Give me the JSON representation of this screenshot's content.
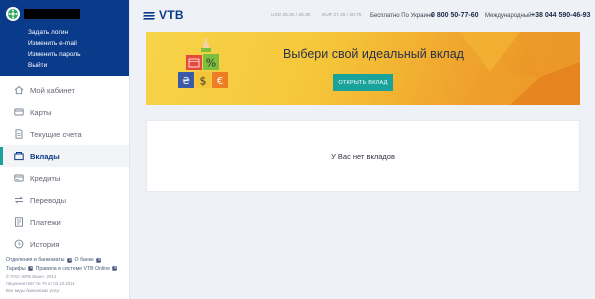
{
  "sidebar": {
    "account_links": [
      "Задать логин",
      "Изменить e-mail",
      "Изменить пароль",
      "Выйти"
    ],
    "menu": [
      {
        "label": "Мой кабинет",
        "icon": "home-icon",
        "active": false
      },
      {
        "label": "Карты",
        "icon": "card-icon",
        "active": false
      },
      {
        "label": "Текущие счета",
        "icon": "document-icon",
        "active": false
      },
      {
        "label": "Вклады",
        "icon": "deposit-icon",
        "active": true
      },
      {
        "label": "Кредиты",
        "icon": "credit-icon",
        "active": false
      },
      {
        "label": "Переводы",
        "icon": "transfer-icon",
        "active": false
      },
      {
        "label": "Платежи",
        "icon": "payment-icon",
        "active": false
      },
      {
        "label": "История",
        "icon": "history-icon",
        "active": false
      }
    ],
    "footer": {
      "branches_link": "Отделения и банкоматы",
      "about_link": "О банке",
      "tariffs_link": "Тарифы",
      "rules_link": "Правила в системе VTB Online",
      "copyright": "© ПАО «ВТБ Банк», 2014",
      "license": "Лицензия НБУ № 79 от 03.10.2011",
      "note": "Все виды банковских услуг"
    }
  },
  "header": {
    "logo_text": "VTB",
    "usd_rate": "USD 25.30 / 26.30",
    "eur_rate": "EUR 27.45 / 28.75",
    "free_label": "Бесплатно По Украине",
    "free_phone": "0 800 50-77-60",
    "intl_label": "Международный",
    "intl_phone": "+38 044 590-46-93"
  },
  "banner": {
    "title": "Выбери свой идеальный вклад",
    "button_label": "ОТКРЫТЬ ВКЛАД",
    "block_glyphs": [
      "%",
      "₴",
      "$",
      "€"
    ]
  },
  "deposits": {
    "empty_text": "У Вас нет вкладов"
  },
  "colors": {
    "brand_blue": "#0a3a8a",
    "accent_teal": "#1aa39a",
    "banner_yellow": "#f6c63a"
  }
}
